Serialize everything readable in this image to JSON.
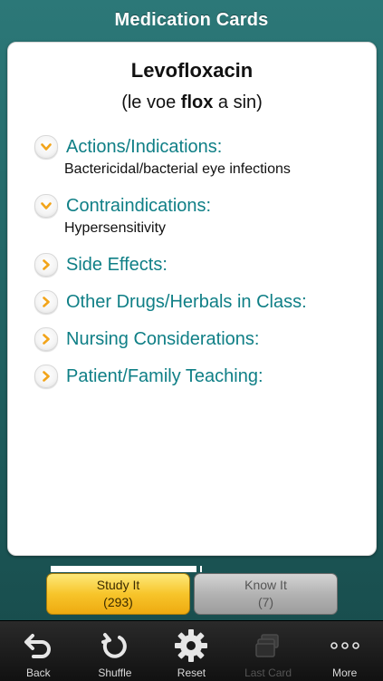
{
  "header": {
    "title": "Medication Cards"
  },
  "card": {
    "drug_name": "Levofloxacin",
    "pronunciation_pre": "(le voe ",
    "pronunciation_bold": "flox",
    "pronunciation_post": " a sin)",
    "sections": [
      {
        "label": "Actions/Indications:",
        "expanded": true,
        "content": "Bactericidal/bacterial eye infections",
        "icon": "chevron-down-icon"
      },
      {
        "label": "Contraindications:",
        "expanded": true,
        "content": "Hypersensitivity",
        "icon": "chevron-down-icon"
      },
      {
        "label": "Side Effects:",
        "expanded": false,
        "icon": "chevron-right-icon"
      },
      {
        "label": "Other Drugs/Herbals in Class:",
        "expanded": false,
        "icon": "chevron-right-icon"
      },
      {
        "label": "Nursing Considerations:",
        "expanded": false,
        "icon": "chevron-right-icon"
      },
      {
        "label": "Patient/Family Teaching:",
        "expanded": false,
        "icon": "chevron-right-icon"
      }
    ]
  },
  "progress": {
    "study_fraction": 0.977
  },
  "buttons": {
    "study": {
      "label": "Study It",
      "count": "(293)"
    },
    "know": {
      "label": "Know It",
      "count": "(7)"
    }
  },
  "toolbar": {
    "back": "Back",
    "shuffle": "Shuffle",
    "reset": "Reset",
    "last_card": "Last Card",
    "more": "More"
  },
  "colors": {
    "accent_teal": "#0f7f86",
    "chevron_orange": "#f2a41a",
    "study_yellow": "#f7c52b",
    "know_gray": "#b3b3b3"
  }
}
